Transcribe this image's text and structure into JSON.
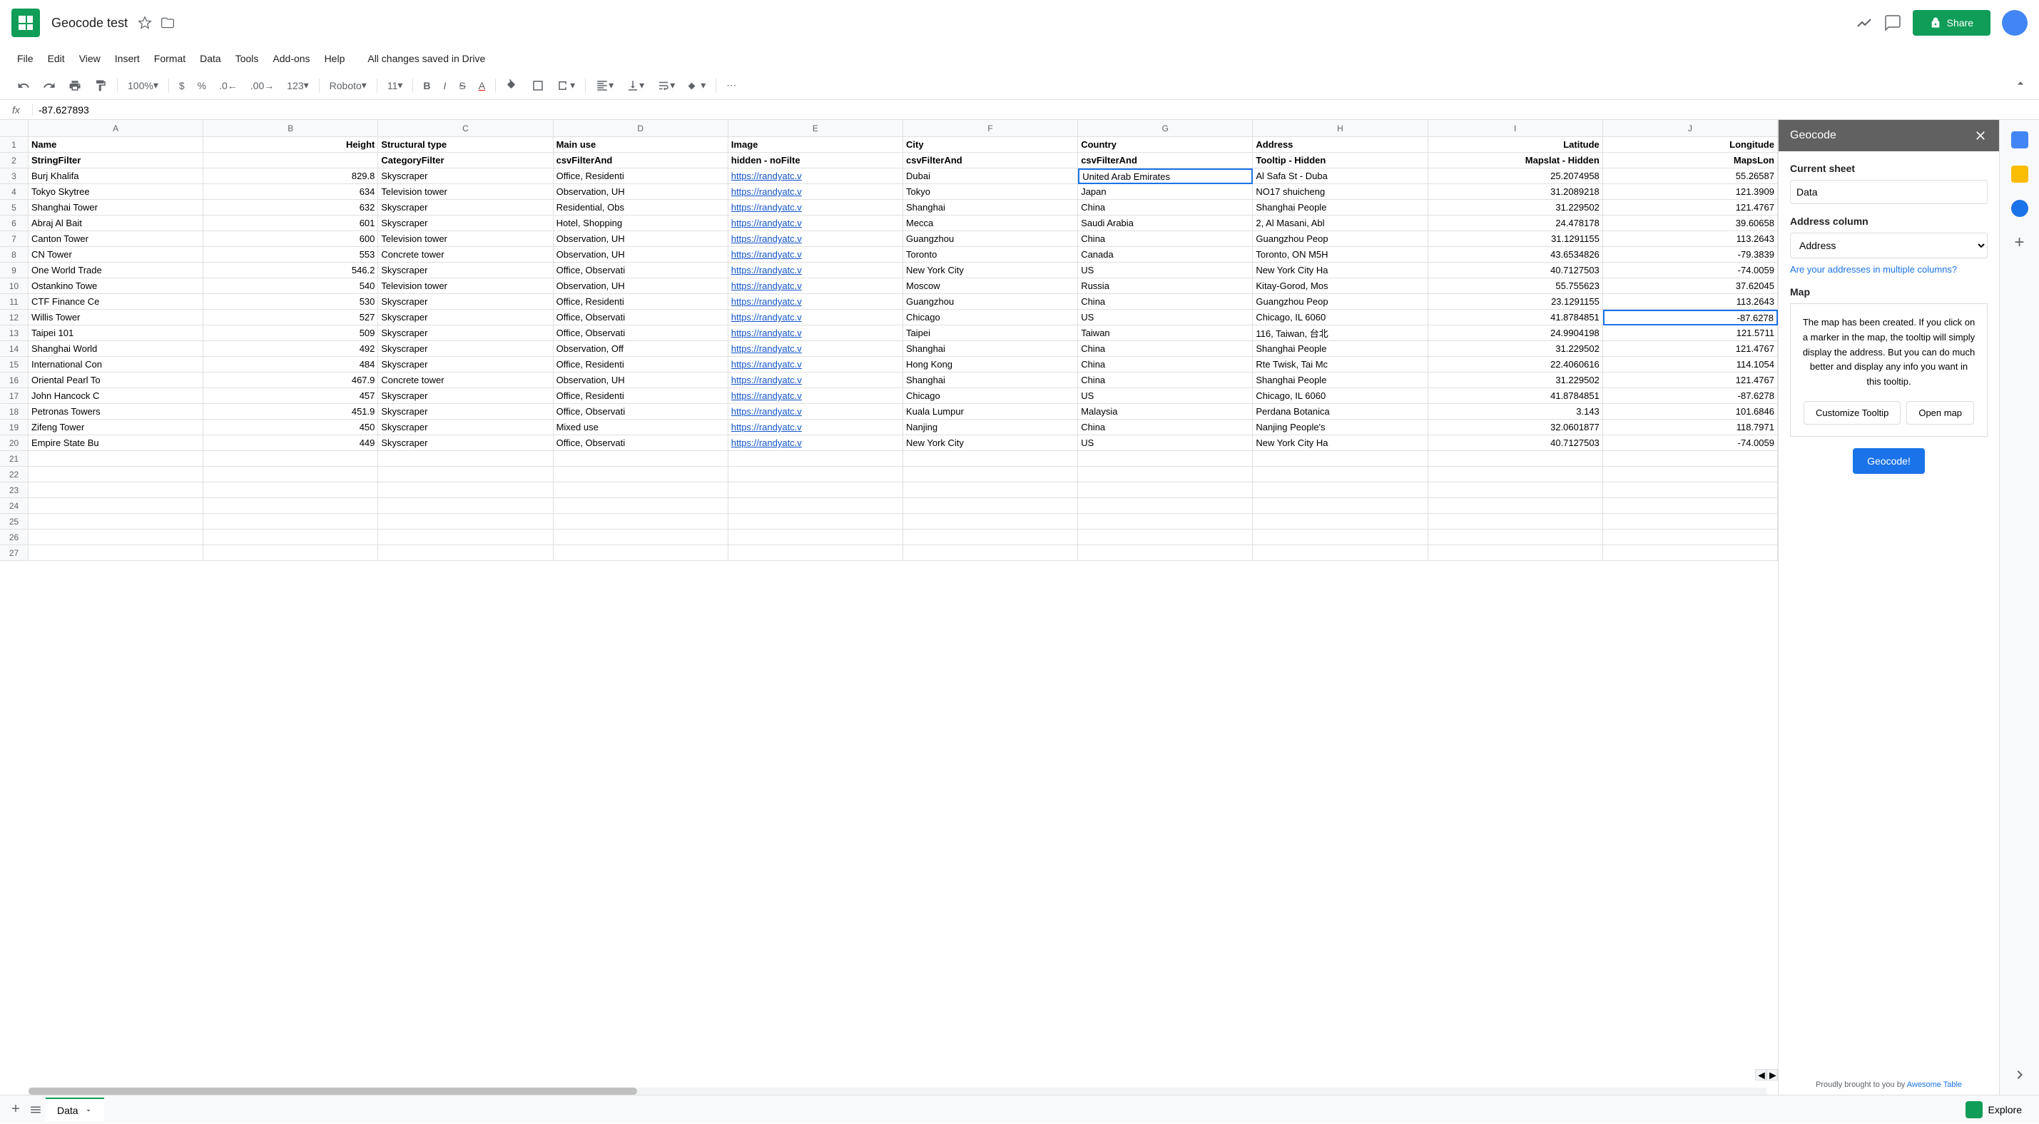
{
  "doc": {
    "title": "Geocode test",
    "save_status": "All changes saved in Drive"
  },
  "menu": {
    "file": "File",
    "edit": "Edit",
    "view": "View",
    "insert": "Insert",
    "format": "Format",
    "data": "Data",
    "tools": "Tools",
    "addons": "Add-ons",
    "help": "Help"
  },
  "toolbar": {
    "zoom": "100%",
    "font": "Roboto",
    "size": "11",
    "formats": "123"
  },
  "formula": {
    "label": "fx",
    "value": "-87.627893"
  },
  "share_label": "Share",
  "columns": [
    "",
    "A",
    "B",
    "C",
    "D",
    "E",
    "F",
    "G",
    "H",
    "I",
    "J"
  ],
  "rows": [
    {
      "n": "1",
      "cells": [
        "Name",
        "Height",
        "Structural type",
        "Main use",
        "Image",
        "City",
        "Country",
        "Address",
        "Latitude",
        "Longitude"
      ],
      "bold": true
    },
    {
      "n": "2",
      "cells": [
        "StringFilter",
        "",
        "CategoryFilter",
        "csvFilterAnd",
        "hidden - noFilte",
        "csvFilterAnd",
        "csvFilterAnd",
        "Tooltip - Hidden",
        "Mapslat - Hidden",
        "MapsLon"
      ],
      "bold": true
    },
    {
      "n": "3",
      "cells": [
        "Burj Khalifa",
        "829.8",
        "Skyscraper",
        "Office, Residenti",
        "https://randyatc.v",
        "Dubai",
        "United Arab Emirates",
        "Al Safa St - Duba",
        "25.2074958",
        "55.26587"
      ]
    },
    {
      "n": "4",
      "cells": [
        "Tokyo Skytree",
        "634",
        "Television tower",
        "Observation, UH",
        "https://randyatc.v",
        "Tokyo",
        "Japan",
        "NO17 shuicheng",
        "31.2089218",
        "121.3909"
      ]
    },
    {
      "n": "5",
      "cells": [
        "Shanghai Tower",
        "632",
        "Skyscraper",
        "Residential, Obs",
        "https://randyatc.v",
        "Shanghai",
        "China",
        "Shanghai People",
        "31.229502",
        "121.4767"
      ]
    },
    {
      "n": "6",
      "cells": [
        "Abraj Al Bait",
        "601",
        "Skyscraper",
        "Hotel, Shopping",
        "https://randyatc.v",
        "Mecca",
        "Saudi Arabia",
        "2, Al Masani, Abl",
        "24.478178",
        "39.60658"
      ]
    },
    {
      "n": "7",
      "cells": [
        "Canton Tower",
        "600",
        "Television tower",
        "Observation, UH",
        "https://randyatc.v",
        "Guangzhou",
        "China",
        "Guangzhou Peop",
        "31.1291155",
        "113.2643"
      ]
    },
    {
      "n": "8",
      "cells": [
        "CN Tower",
        "553",
        "Concrete tower",
        "Observation, UH",
        "https://randyatc.v",
        "Toronto",
        "Canada",
        "Toronto, ON M5H",
        "43.6534826",
        "-79.3839"
      ]
    },
    {
      "n": "9",
      "cells": [
        "One World Trade",
        "546.2",
        "Skyscraper",
        "Office, Observati",
        "https://randyatc.v",
        "New York City",
        "US",
        "New York City Ha",
        "40.7127503",
        "-74.0059"
      ]
    },
    {
      "n": "10",
      "cells": [
        "Ostankino Towe",
        "540",
        "Television tower",
        "Observation, UH",
        "https://randyatc.v",
        "Moscow",
        "Russia",
        "Kitay-Gorod, Mos",
        "55.755623",
        "37.62045"
      ]
    },
    {
      "n": "11",
      "cells": [
        "CTF Finance Ce",
        "530",
        "Skyscraper",
        "Office, Residenti",
        "https://randyatc.v",
        "Guangzhou",
        "China",
        "Guangzhou Peop",
        "23.1291155",
        "113.2643"
      ]
    },
    {
      "n": "12",
      "cells": [
        "Willis Tower",
        "527",
        "Skyscraper",
        "Office, Observati",
        "https://randyatc.v",
        "Chicago",
        "US",
        "Chicago, IL 6060",
        "41.8784851",
        "-87.6278"
      ]
    },
    {
      "n": "13",
      "cells": [
        "Taipei 101",
        "509",
        "Skyscraper",
        "Office, Observati",
        "https://randyatc.v",
        "Taipei",
        "Taiwan",
        "116, Taiwan, 台北",
        "24.9904198",
        "121.5711"
      ]
    },
    {
      "n": "14",
      "cells": [
        "Shanghai World",
        "492",
        "Skyscraper",
        "Observation, Off",
        "https://randyatc.v",
        "Shanghai",
        "China",
        "Shanghai People",
        "31.229502",
        "121.4767"
      ]
    },
    {
      "n": "15",
      "cells": [
        "International Con",
        "484",
        "Skyscraper",
        "Office, Residenti",
        "https://randyatc.v",
        "Hong Kong",
        "China",
        "Rte Twisk, Tai Mc",
        "22.4060616",
        "114.1054"
      ]
    },
    {
      "n": "16",
      "cells": [
        "Oriental Pearl To",
        "467.9",
        "Concrete tower",
        "Observation, UH",
        "https://randyatc.v",
        "Shanghai",
        "China",
        "Shanghai People",
        "31.229502",
        "121.4767"
      ]
    },
    {
      "n": "17",
      "cells": [
        "John Hancock C",
        "457",
        "Skyscraper",
        "Office, Residenti",
        "https://randyatc.v",
        "Chicago",
        "US",
        "Chicago, IL 6060",
        "41.8784851",
        "-87.6278"
      ]
    },
    {
      "n": "18",
      "cells": [
        "Petronas Towers",
        "451.9",
        "Skyscraper",
        "Office, Observati",
        "https://randyatc.v",
        "Kuala Lumpur",
        "Malaysia",
        "Perdana Botanica",
        "3.143",
        "101.6846"
      ]
    },
    {
      "n": "19",
      "cells": [
        "Zifeng Tower",
        "450",
        "Skyscraper",
        "Mixed use",
        "https://randyatc.v",
        "Nanjing",
        "China",
        "Nanjing People's",
        "32.0601877",
        "118.7971"
      ]
    },
    {
      "n": "20",
      "cells": [
        "Empire State Bu",
        "449",
        "Skyscraper",
        "Office, Observati",
        "https://randyatc.v",
        "New York City",
        "US",
        "New York City Ha",
        "40.7127503",
        "-74.0059"
      ]
    },
    {
      "n": "21",
      "cells": [
        "",
        "",
        "",
        "",
        "",
        "",
        "",
        "",
        "",
        ""
      ]
    },
    {
      "n": "22",
      "cells": [
        "",
        "",
        "",
        "",
        "",
        "",
        "",
        "",
        "",
        ""
      ]
    },
    {
      "n": "23",
      "cells": [
        "",
        "",
        "",
        "",
        "",
        "",
        "",
        "",
        "",
        ""
      ]
    },
    {
      "n": "24",
      "cells": [
        "",
        "",
        "",
        "",
        "",
        "",
        "",
        "",
        "",
        ""
      ]
    },
    {
      "n": "25",
      "cells": [
        "",
        "",
        "",
        "",
        "",
        "",
        "",
        "",
        "",
        ""
      ]
    },
    {
      "n": "26",
      "cells": [
        "",
        "",
        "",
        "",
        "",
        "",
        "",
        "",
        "",
        ""
      ]
    },
    {
      "n": "27",
      "cells": [
        "",
        "",
        "",
        "",
        "",
        "",
        "",
        "",
        "",
        ""
      ]
    }
  ],
  "selected_cell": {
    "row": 12,
    "col": 10
  },
  "highlighted_cell": {
    "row": 3,
    "col": 7
  },
  "sidebar": {
    "title": "Geocode",
    "current_sheet_label": "Current sheet",
    "current_sheet_value": "Data",
    "address_column_label": "Address column",
    "address_column_value": "Address",
    "multi_link": "Are your addresses in multiple columns?",
    "map_label": "Map",
    "map_text": "The map has been created. If you click on a marker in the map, the tooltip will simply display the address. But you can do much better and display any info you want in this tooltip.",
    "customize_btn": "Customize Tooltip",
    "open_btn": "Open map",
    "geocode_btn": "Geocode!",
    "footer_text": "Proudly brought to you by ",
    "footer_link": "Awesome Table"
  },
  "bottom": {
    "sheet_name": "Data",
    "explore": "Explore"
  }
}
